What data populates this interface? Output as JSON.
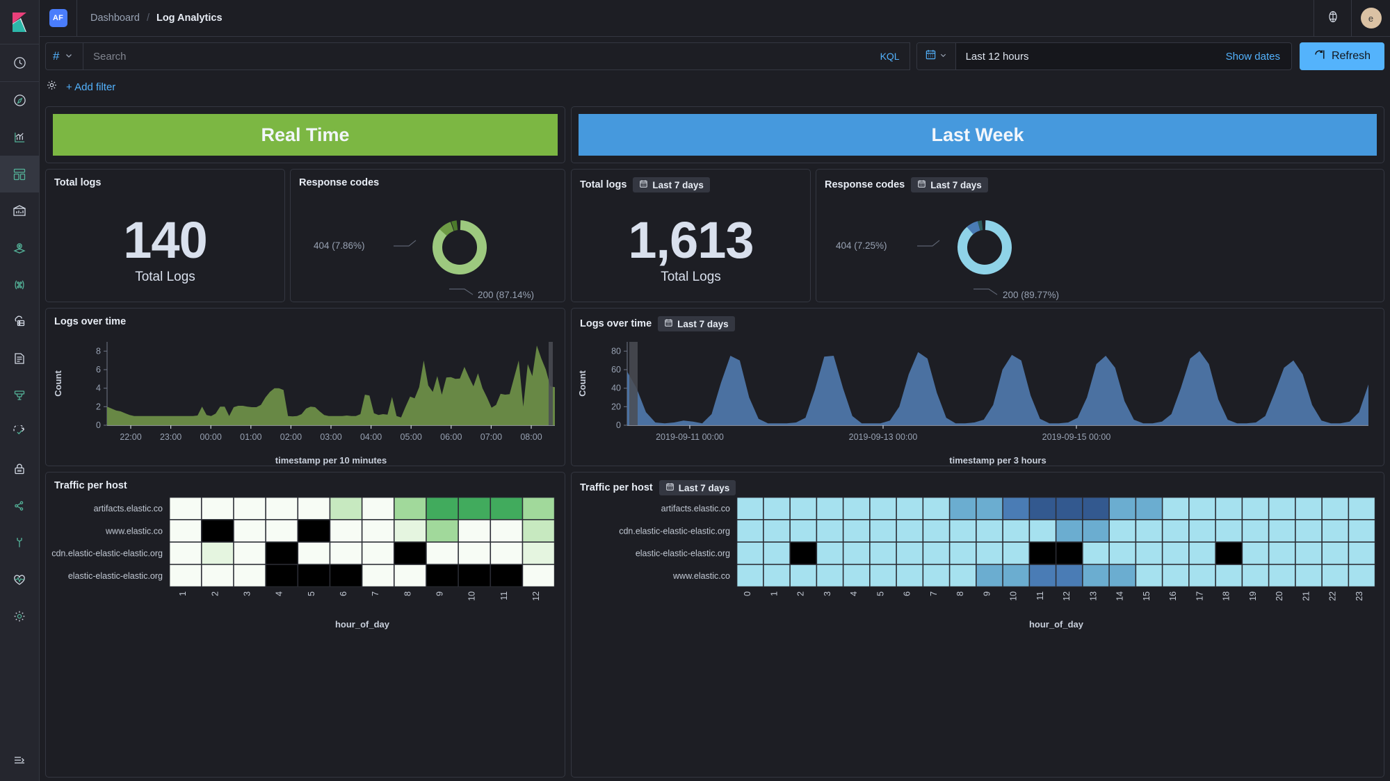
{
  "header": {
    "space_badge": "AF",
    "breadcrumb_root": "Dashboard",
    "breadcrumb_sep": "/",
    "breadcrumb_current": "Log Analytics",
    "help_icon": "help-icon",
    "avatar_initial": "e"
  },
  "query": {
    "index_icon": "#",
    "index_chevron": "chevron-down-icon",
    "placeholder": "Search",
    "value": "",
    "language": "KQL",
    "calendar_icon": "calendar-icon",
    "date_range": "Last 12 hours",
    "show_dates": "Show dates",
    "refresh_label": "Refresh",
    "refresh_icon": "refresh-icon"
  },
  "filters": {
    "gear_icon": "gear-icon",
    "add_filter": "+ Add filter"
  },
  "sidebar": {
    "logo": "kibana-logo",
    "items": [
      {
        "name": "recently-viewed",
        "icon": "clock-icon"
      },
      {
        "name": "discover",
        "icon": "compass-icon"
      },
      {
        "name": "visualize",
        "icon": "bar-chart-icon"
      },
      {
        "name": "dashboard",
        "icon": "dashboard-icon",
        "active": true
      },
      {
        "name": "canvas",
        "icon": "canvas-icon"
      },
      {
        "name": "maps",
        "icon": "map-marker-icon"
      },
      {
        "name": "machine-learning",
        "icon": "ml-nodes-icon"
      },
      {
        "name": "infrastructure",
        "icon": "cloud-server-icon"
      },
      {
        "name": "logs",
        "icon": "document-icon"
      },
      {
        "name": "apm",
        "icon": "apm-icon"
      },
      {
        "name": "uptime",
        "icon": "uptime-check-icon"
      },
      {
        "name": "siem",
        "icon": "lock-icon"
      },
      {
        "name": "dev-tools",
        "icon": "share-nodes-icon"
      },
      {
        "name": "management",
        "icon": "wrench-icon"
      },
      {
        "name": "monitoring",
        "icon": "heartbeat-icon"
      },
      {
        "name": "stack-management",
        "icon": "gear-icon"
      }
    ],
    "collapse_icon": "collapse-icon"
  },
  "panels": {
    "banner_left": "Real Time",
    "banner_right": "Last Week",
    "banner_left_color": "#7cb743",
    "banner_right_color": "#4699dd",
    "total_logs_title": "Total logs",
    "response_codes_title": "Response codes",
    "logs_over_time_title": "Logs over time",
    "traffic_per_host_title": "Traffic per host",
    "last_7_days_badge": "Last 7 days",
    "calendar_icon": "calendar-icon"
  },
  "chart_data": [
    {
      "id": "total-logs-realtime",
      "type": "metric",
      "title": "Total logs",
      "value": "140",
      "label": "Total Logs",
      "color": "#d9e0ed"
    },
    {
      "id": "response-codes-realtime",
      "type": "pie",
      "title": "Response codes",
      "variant": "donut",
      "labels": [
        "404 (7.86%)",
        "200 (87.14%)"
      ],
      "slices": [
        {
          "name": "200",
          "percent": 87.14,
          "label": "200 (87.14%)",
          "color": "#9dc97f"
        },
        {
          "name": "404",
          "percent": 7.86,
          "label": "404 (7.86%)",
          "color": "#6e9b45"
        },
        {
          "name": "other",
          "percent": 5.0,
          "label": "",
          "color": "#4c7a2b"
        }
      ],
      "legend_position": "outside-labels"
    },
    {
      "id": "total-logs-lastweek",
      "type": "metric",
      "title": "Total logs",
      "badge": "Last 7 days",
      "value": "1,613",
      "label": "Total Logs",
      "color": "#d9e0ed"
    },
    {
      "id": "response-codes-lastweek",
      "type": "pie",
      "title": "Response codes",
      "badge": "Last 7 days",
      "variant": "donut",
      "labels": [
        "404 (7.25%)",
        "200 (89.77%)"
      ],
      "slices": [
        {
          "name": "200",
          "percent": 89.77,
          "label": "200 (89.77%)",
          "color": "#8fd3e8"
        },
        {
          "name": "404",
          "percent": 7.25,
          "label": "404 (7.25%)",
          "color": "#4a7cb5"
        },
        {
          "name": "other",
          "percent": 2.98,
          "label": "",
          "color": "#2c5e5e"
        }
      ],
      "legend_position": "outside-labels"
    },
    {
      "id": "logs-over-time-realtime",
      "type": "area",
      "title": "Logs over time",
      "ylabel": "Count",
      "xlabel": "timestamp per 10 minutes",
      "ylim": [
        0,
        9
      ],
      "yticks": [
        0,
        2,
        4,
        6,
        8
      ],
      "xticks": [
        "22:00",
        "23:00",
        "00:00",
        "01:00",
        "02:00",
        "03:00",
        "04:00",
        "05:00",
        "06:00",
        "07:00",
        "08:00"
      ],
      "color": "#6a8b46",
      "values": [
        2.0,
        1.8,
        1.6,
        1.5,
        1.3,
        1.1,
        1.0,
        1.0,
        1.0,
        1.0,
        1.0,
        1.0,
        1.0,
        1.0,
        1.0,
        1.0,
        1.0,
        1.0,
        1.0,
        1.0,
        1.05,
        2.0,
        1.1,
        1.0,
        1.25,
        2.0,
        2.0,
        1.0,
        1.95,
        2.1,
        2.1,
        2.0,
        1.95,
        1.95,
        2.2,
        3.0,
        3.6,
        4.0,
        4.0,
        3.8,
        1.0,
        0.95,
        1.0,
        1.2,
        1.8,
        2.0,
        1.95,
        1.5,
        1.1,
        1.0,
        1.0,
        1.0,
        1.0,
        1.05,
        1.0,
        1.0,
        1.2,
        3.3,
        3.2,
        1.3,
        1.1,
        1.2,
        1.15,
        3.05,
        1.0,
        0.85,
        2.0,
        3.1,
        2.9,
        4.1,
        7.0,
        4.3,
        3.6,
        5.3,
        3.3,
        5.15,
        5.2,
        5.0,
        5.05,
        6.3,
        5.2,
        4.2,
        5.6,
        4.0,
        3.0,
        1.9,
        2.2,
        3.4,
        3.3,
        3.35,
        5.2,
        7.0,
        2.0,
        6.6,
        5.3,
        8.6,
        7.2,
        6.0,
        4.2,
        4.1
      ]
    },
    {
      "id": "logs-over-time-lastweek",
      "type": "area",
      "title": "Logs over time",
      "badge": "Last 7 days",
      "ylabel": "Count",
      "xlabel": "timestamp per 3 hours",
      "ylim": [
        0,
        90
      ],
      "yticks": [
        0,
        20,
        40,
        60,
        80
      ],
      "xticks": [
        "2019-09-11 00:00",
        "2019-09-13 00:00",
        "2019-09-15 00:00"
      ],
      "color": "#4c74a5",
      "values": [
        58,
        40,
        14,
        3,
        2,
        3,
        5,
        4,
        2,
        12,
        46,
        75,
        70,
        30,
        7,
        2,
        2,
        2,
        3,
        8,
        38,
        74,
        75,
        40,
        10,
        2,
        2,
        2,
        5,
        20,
        55,
        79,
        72,
        35,
        8,
        2,
        2,
        3,
        6,
        22,
        60,
        76,
        70,
        32,
        7,
        2,
        2,
        3,
        8,
        30,
        66,
        75,
        62,
        26,
        6,
        2,
        2,
        4,
        12,
        40,
        72,
        80,
        66,
        28,
        6,
        2,
        2,
        3,
        10,
        35,
        62,
        70,
        55,
        22,
        5,
        2,
        2,
        4,
        14,
        44
      ]
    },
    {
      "id": "traffic-per-host-realtime",
      "type": "heatmap",
      "title": "Traffic per host",
      "xlabel": "hour_of_day",
      "rows": [
        "artifacts.elastic.co",
        "www.elastic.co",
        "cdn.elastic-elastic-elastic.org",
        "elastic-elastic-elastic.org"
      ],
      "columns": [
        "1",
        "2",
        "3",
        "4",
        "5",
        "6",
        "7",
        "8",
        "9",
        "10",
        "11",
        "12"
      ],
      "palette": [
        "#000000",
        "#f7fcf5",
        "#e5f5e0",
        "#c7e9c0",
        "#a1d99b",
        "#74c476",
        "#41ab5d",
        "#238b45"
      ],
      "cells": [
        [
          1,
          1,
          1,
          1,
          1,
          3,
          1,
          4,
          6,
          6,
          6,
          4
        ],
        [
          1,
          0,
          1,
          1,
          0,
          1,
          1,
          2,
          4,
          1,
          1,
          3
        ],
        [
          1,
          2,
          1,
          0,
          1,
          1,
          1,
          0,
          1,
          1,
          1,
          2
        ],
        [
          1,
          1,
          1,
          0,
          0,
          0,
          1,
          1,
          0,
          0,
          0,
          1
        ]
      ]
    },
    {
      "id": "traffic-per-host-lastweek",
      "type": "heatmap",
      "title": "Traffic per host",
      "badge": "Last 7 days",
      "xlabel": "hour_of_day",
      "rows": [
        "artifacts.elastic.co",
        "cdn.elastic-elastic-elastic.org",
        "elastic-elastic-elastic.org",
        "www.elastic.co"
      ],
      "columns": [
        "0",
        "1",
        "2",
        "3",
        "4",
        "5",
        "6",
        "7",
        "8",
        "9",
        "10",
        "11",
        "12",
        "13",
        "14",
        "15",
        "16",
        "17",
        "18",
        "19",
        "20",
        "21",
        "22",
        "23"
      ],
      "palette": [
        "#000000",
        "#a6e1ef",
        "#8ecfe4",
        "#6badd0",
        "#4a7cb5",
        "#33598f",
        "#2a4a78",
        "#1d3a63"
      ],
      "cells": [
        [
          1,
          1,
          1,
          1,
          1,
          1,
          1,
          1,
          3,
          3,
          4,
          5,
          5,
          5,
          3,
          3,
          1,
          1,
          1,
          1,
          1,
          1,
          1,
          1
        ],
        [
          1,
          1,
          1,
          1,
          1,
          1,
          1,
          1,
          1,
          1,
          1,
          1,
          3,
          3,
          1,
          1,
          1,
          1,
          1,
          1,
          1,
          1,
          1,
          1
        ],
        [
          1,
          1,
          0,
          1,
          1,
          1,
          1,
          1,
          1,
          1,
          1,
          0,
          0,
          1,
          1,
          1,
          1,
          1,
          0,
          1,
          1,
          1,
          1,
          1
        ],
        [
          1,
          1,
          1,
          1,
          1,
          1,
          1,
          1,
          1,
          3,
          3,
          4,
          4,
          3,
          3,
          1,
          1,
          1,
          1,
          1,
          1,
          1,
          1,
          1
        ]
      ]
    }
  ]
}
